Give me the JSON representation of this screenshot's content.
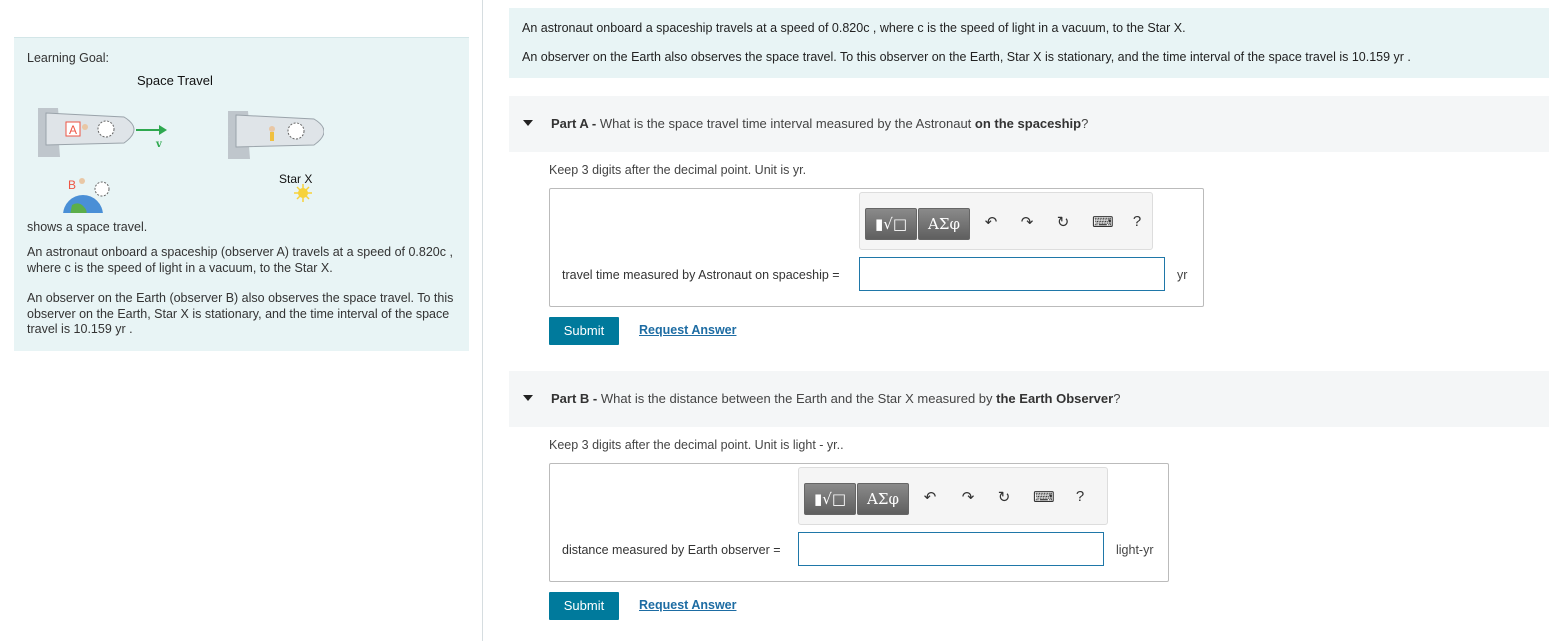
{
  "left": {
    "learning_goal": "Learning Goal:",
    "figure": {
      "title": "Space Travel",
      "label_a": "A",
      "label_b": "B",
      "label_v": "v",
      "label_star": "Star X"
    },
    "caption": "shows a space travel.",
    "para1": "An astronaut onboard a spaceship (observer A) travels at a speed of 0.820c , where c is the speed of light in a vacuum, to the Star X.",
    "para2": "An observer on the Earth (observer B) also observes the space travel. To this observer on the Earth, Star X is stationary, and the time interval of the space travel is 10.159 yr ."
  },
  "intro": {
    "line1": "An astronaut onboard a spaceship travels at a speed of 0.820c , where c is the speed of light in a vacuum, to the Star X.",
    "line2": "An observer on the Earth also observes the space travel. To this observer on the Earth, Star X is stationary, and the time interval of the space travel is 10.159 yr ."
  },
  "partA": {
    "label": "Part A -",
    "question_pre": "What is the space travel time interval measured by the Astronaut",
    "question_emph": "on the spaceship",
    "question_post": "?",
    "hint": "Keep 3 digits after the decimal point. Unit is yr.",
    "answer_label": "travel time measured by Astronaut on spaceship =",
    "unit": "yr",
    "answer_value": "",
    "submit": "Submit",
    "request": "Request Answer"
  },
  "partB": {
    "label": "Part B -",
    "question_pre": "What is the distance between the Earth and the Star X measured by",
    "question_emph": "the Earth Observer",
    "question_post": "?",
    "hint": "Keep 3 digits after the decimal point. Unit is light - yr..",
    "answer_label": "distance measured by Earth observer =",
    "unit": "light-yr",
    "answer_value": "",
    "submit": "Submit",
    "request": "Request Answer"
  },
  "toolbar": {
    "templates": "▮√□",
    "symbols": "ΑΣφ",
    "undo": "↶",
    "redo": "↷",
    "reset": "↻",
    "keyboard": "⌨",
    "help": "?"
  },
  "colors": {
    "panel_bg": "#e8f4f5",
    "submit_bg": "#007a9c",
    "link": "#1d6ca3",
    "input_border": "#1f77a8"
  }
}
